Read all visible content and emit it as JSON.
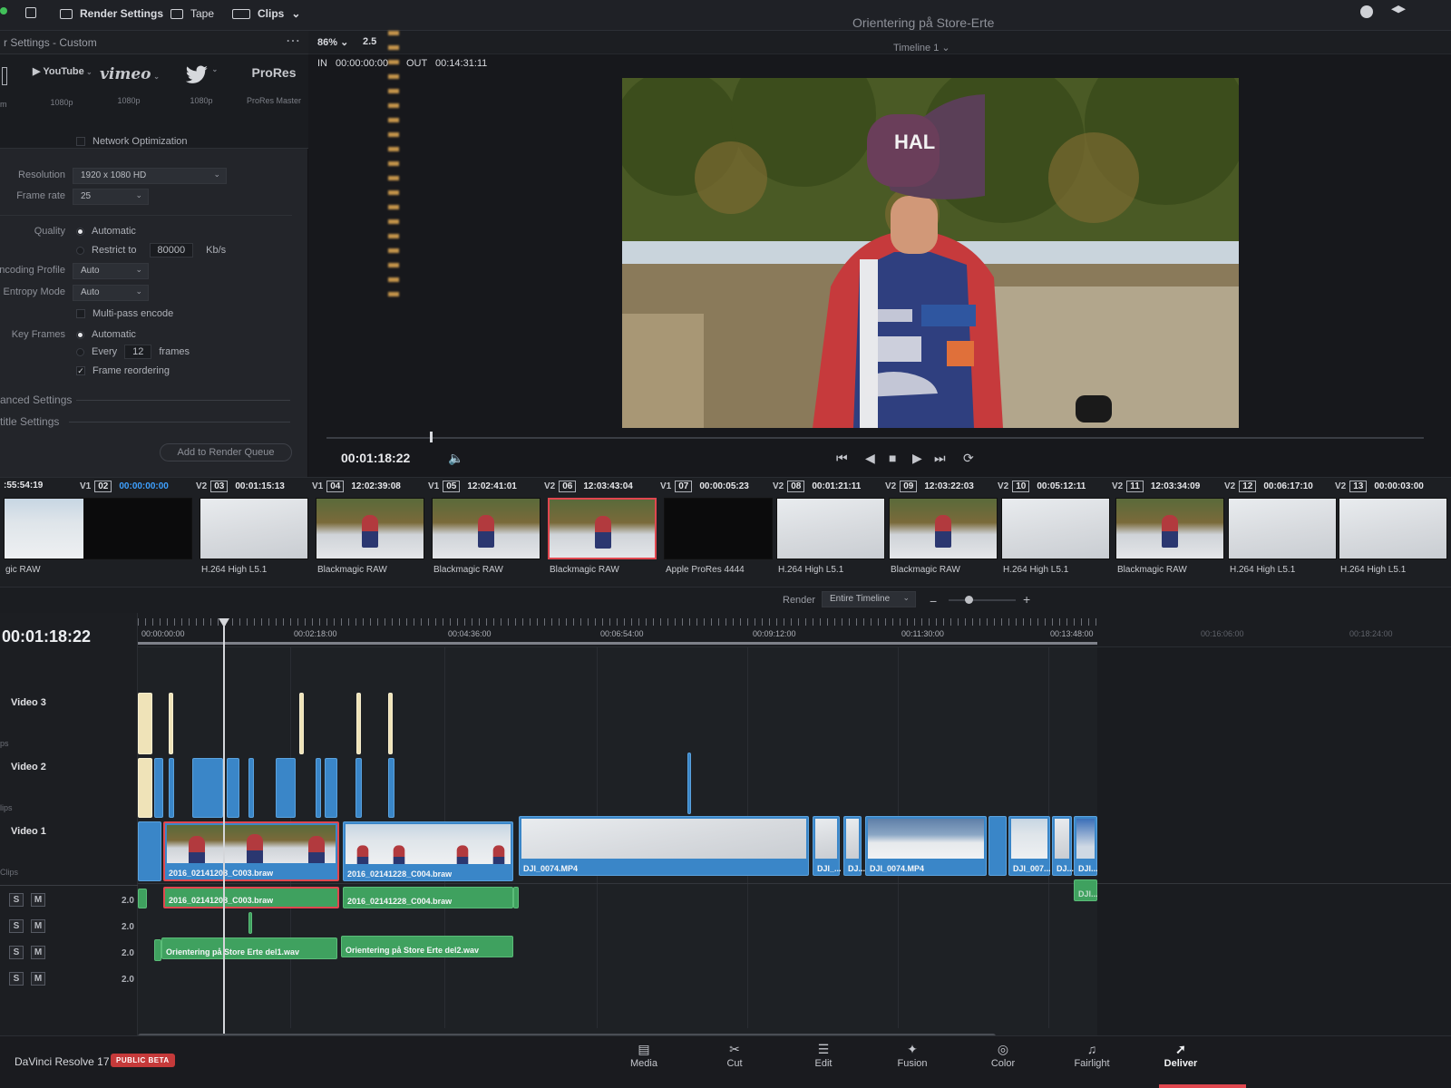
{
  "toolbar": {
    "render_settings": "Render Settings",
    "tape": "Tape",
    "clips": "Clips",
    "viewer_title": "Orientering på Store-Erte"
  },
  "panel": {
    "header": "r Settings - Custom",
    "presets": [
      {
        "name": "YouTube",
        "sub": "1080p"
      },
      {
        "name": "vimeo",
        "sub": "1080p"
      },
      {
        "name": "twitter-icon",
        "sub": "1080p"
      },
      {
        "name": "ProRes",
        "sub": "ProRes Master"
      }
    ],
    "network_optimization": "Network Optimization",
    "resolution_label": "Resolution",
    "resolution_value": "1920 x 1080 HD",
    "framerate_label": "Frame rate",
    "framerate_value": "25",
    "quality_label": "Quality",
    "quality_automatic": "Automatic",
    "restrict_to": "Restrict to",
    "restrict_value": "80000",
    "restrict_unit": "Kb/s",
    "encoding_profile_label": "ncoding Profile",
    "encoding_profile_value": "Auto",
    "entropy_mode_label": "Entropy Mode",
    "entropy_mode_value": "Auto",
    "multipass": "Multi-pass encode",
    "keyframes_label": "Key Frames",
    "keyframes_automatic": "Automatic",
    "every": "Every",
    "every_value": "12",
    "frames": "frames",
    "frame_reordering": "Frame reordering",
    "advanced_settings": "anced Settings",
    "subtitle_settings": "title Settings",
    "add_to_queue": "Add to Render Queue"
  },
  "viewer": {
    "zoom": "86%",
    "zoom2": "2.5",
    "timeline_name": "Timeline 1",
    "in_label": "IN",
    "in_tc": "00:00:00:00",
    "out_label": "OUT",
    "out_tc": "00:14:31:11",
    "current_tc": "00:01:18:22"
  },
  "clips": [
    {
      "track": "",
      "num": "",
      "tc": ":55:54:19",
      "codec": "gic RAW",
      "thumb": "snow-person",
      "selected": false
    },
    {
      "track": "V1",
      "num": "02",
      "tc": "00:00:00:00",
      "codec": "",
      "thumb": "black",
      "selected": false,
      "tc_color": "#3ea0ff"
    },
    {
      "track": "V2",
      "num": "03",
      "tc": "00:01:15:13",
      "codec": "H.264 High L5.1",
      "thumb": "snow",
      "selected": false
    },
    {
      "track": "V1",
      "num": "04",
      "tc": "12:02:39:08",
      "codec": "Blackmagic RAW",
      "thumb": "person",
      "selected": false
    },
    {
      "track": "V1",
      "num": "05",
      "tc": "12:02:41:01",
      "codec": "Blackmagic RAW",
      "thumb": "person",
      "selected": false
    },
    {
      "track": "V2",
      "num": "06",
      "tc": "12:03:43:04",
      "codec": "Blackmagic RAW",
      "thumb": "person",
      "selected": true
    },
    {
      "track": "V1",
      "num": "07",
      "tc": "00:00:05:23",
      "codec": "Apple ProRes 4444",
      "thumb": "black",
      "selected": false
    },
    {
      "track": "V2",
      "num": "08",
      "tc": "00:01:21:11",
      "codec": "H.264 High L5.1",
      "thumb": "snow",
      "selected": false
    },
    {
      "track": "V2",
      "num": "09",
      "tc": "12:03:22:03",
      "codec": "Blackmagic RAW",
      "thumb": "person",
      "selected": false
    },
    {
      "track": "V2",
      "num": "10",
      "tc": "00:05:12:11",
      "codec": "H.264 High L5.1",
      "thumb": "snow",
      "selected": false
    },
    {
      "track": "V2",
      "num": "11",
      "tc": "12:03:34:09",
      "codec": "Blackmagic RAW",
      "thumb": "person",
      "selected": false
    },
    {
      "track": "V2",
      "num": "12",
      "tc": "00:06:17:10",
      "codec": "H.264 High L5.1",
      "thumb": "snow",
      "selected": false
    },
    {
      "track": "V2",
      "num": "13",
      "tc": "00:00:03:00",
      "codec": "H.264 High L5.1",
      "thumb": "snow",
      "selected": false
    }
  ],
  "render": {
    "label": "Render",
    "value": "Entire Timeline"
  },
  "timeline": {
    "timecode": "00:01:18:22",
    "ruler": [
      "00:00:00:00",
      "00:02:18:00",
      "00:04:36:00",
      "00:06:54:00",
      "00:09:12:00",
      "00:11:30:00",
      "00:13:48:00",
      "00:16:06:00",
      "00:18:24:00"
    ],
    "tracks": {
      "video3": "Video 3",
      "video2": "Video 2",
      "video1": "Video 1",
      "sub": "ps",
      "sub2": "lips",
      "sub3": "Clips"
    },
    "audio_volume": "2.0",
    "solo": "S",
    "mute": "M",
    "v1_clips": [
      {
        "label": "2016_02141208_C003.braw"
      },
      {
        "label": "2016_02141228_C004.braw"
      },
      {
        "label": "DJI_0074.MP4"
      },
      {
        "label": "DJI_..."
      },
      {
        "label": "DJ..."
      },
      {
        "label": "DJI_0074.MP4"
      },
      {
        "label": "DJI_007..."
      },
      {
        "label": "DJ..."
      },
      {
        "label": "DJI..."
      }
    ],
    "a1_clips": [
      {
        "label": "2016_02141208_C003.braw"
      },
      {
        "label": "2016_02141228_C004.braw"
      },
      {
        "label": "DJI..."
      }
    ],
    "a3_clips": [
      {
        "label": "Orientering på Store Erte del1.wav"
      },
      {
        "label": "Orientering på Store Erte del2.wav"
      }
    ]
  },
  "app": {
    "name": "DaVinci Resolve 17",
    "badge": "PUBLIC BETA"
  },
  "pages": [
    {
      "label": "Media",
      "icon": "media-icon"
    },
    {
      "label": "Cut",
      "icon": "cut-icon"
    },
    {
      "label": "Edit",
      "icon": "edit-icon"
    },
    {
      "label": "Fusion",
      "icon": "fusion-icon"
    },
    {
      "label": "Color",
      "icon": "color-icon"
    },
    {
      "label": "Fairlight",
      "icon": "fairlight-icon"
    },
    {
      "label": "Deliver",
      "icon": "deliver-icon",
      "active": true
    }
  ],
  "colors": {
    "accent_red": "#e0474f",
    "clip_blue": "#3a86c8",
    "clip_green": "#3fa15f",
    "clip_cream": "#efe3b8",
    "tc_blue": "#3ea0ff"
  }
}
